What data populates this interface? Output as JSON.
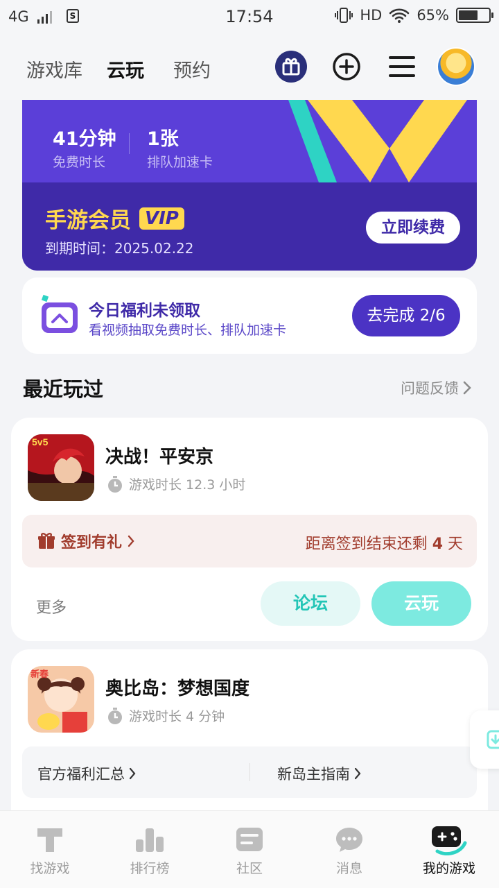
{
  "status_bar": {
    "network": "4G",
    "time": "17:54",
    "hd": "HD",
    "battery": "65%",
    "battery_level": 0.65
  },
  "top_nav": {
    "tabs": [
      {
        "label": "游戏库"
      },
      {
        "label": "云玩",
        "active": true
      },
      {
        "label": "预约"
      }
    ],
    "icons": [
      "gift-icon",
      "add-icon",
      "menu-icon",
      "avatar"
    ]
  },
  "membership": {
    "stats": [
      {
        "value": "41分钟",
        "label": "免费时长"
      },
      {
        "value": "1张",
        "label": "排队加速卡"
      }
    ],
    "title": "手游会员",
    "badge": "VIP",
    "expire": "到期时间：2025.02.22",
    "renew_label": "立即续费",
    "colors": {
      "card": "#5b3fd8",
      "gold": "#ffd84f"
    }
  },
  "welfare": {
    "title": "今日福利未领取",
    "subtitle": "看视频抽取免费时长、排队加速卡",
    "button": "去完成 2/6"
  },
  "recent": {
    "title": "最近玩过",
    "feedback": "问题反馈"
  },
  "games": [
    {
      "name": "决战！平安京",
      "playtime": "游戏时长 12.3 小时",
      "signin_label": "签到有礼",
      "signin_countdown_prefix": "距离签到结束还剩 ",
      "signin_countdown_days": "4",
      "signin_countdown_suffix": " 天",
      "more": "更多",
      "forum": "论坛",
      "cloud_play": "云玩"
    },
    {
      "name": "奥比岛：梦想国度",
      "playtime": "游戏时长 4 分钟",
      "links": [
        "官方福利汇总",
        "新岛主指南"
      ]
    }
  ],
  "bottom_nav": [
    {
      "label": "找游戏",
      "icon": "find-game-icon"
    },
    {
      "label": "排行榜",
      "icon": "ranking-icon"
    },
    {
      "label": "社区",
      "icon": "community-icon"
    },
    {
      "label": "消息",
      "icon": "message-icon"
    },
    {
      "label": "我的游戏",
      "icon": "gamepad-icon",
      "active": true
    }
  ]
}
